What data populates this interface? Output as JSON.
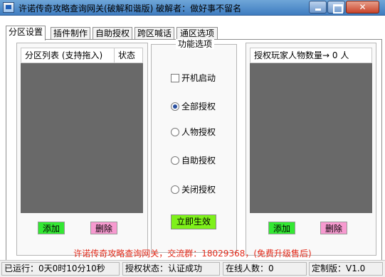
{
  "window": {
    "title": "许诺传奇攻略查询网关(破解和谐版) 破解者：做好事不留名"
  },
  "tabs": [
    {
      "label": "分区设置",
      "active": true
    },
    {
      "label": "插件制作",
      "active": false
    },
    {
      "label": "自助授权",
      "active": false
    },
    {
      "label": "跨区喊话",
      "active": false
    },
    {
      "label": "通区选项",
      "active": false
    }
  ],
  "partition_list": {
    "header_col1": "分区列表 (支持拖入)",
    "header_col2": "状态",
    "add_label": "添加",
    "delete_label": "删除"
  },
  "options": {
    "group_title": "功能选项",
    "autostart_label": "开机启动",
    "autostart_checked": false,
    "radios": [
      {
        "label": "全部授权",
        "selected": true
      },
      {
        "label": "人物授权",
        "selected": false
      },
      {
        "label": "自助授权",
        "selected": false
      },
      {
        "label": "关闭授权",
        "selected": false
      }
    ],
    "apply_label": "立即生效"
  },
  "auth_players": {
    "header": "授权玩家人物数量→ 0 人",
    "add_label": "添加",
    "delete_label": "删除"
  },
  "notice": "许诺传奇攻略查询网关，交流群：18029368，(免费升级售后)",
  "status": {
    "uptime": "已运行：0天0时10分10秒",
    "auth_status": "授权状态：认证成功",
    "online_count": "在线人数：0",
    "edition": "定制版：V1.0"
  },
  "colors": {
    "list_bg": "#696969",
    "add_button": "#33e833",
    "delete_button": "#f79ad0",
    "apply_button": "#7ef11a",
    "notice_text": "#e22a1a",
    "radio_selected_dot": "#2a50a0"
  }
}
